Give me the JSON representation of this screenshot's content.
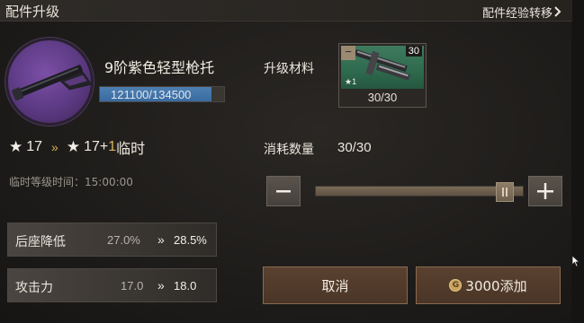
{
  "header": {
    "title": "配件升级",
    "transfer_label": "配件经验转移"
  },
  "weapon": {
    "name": "9阶紫色轻型枪托",
    "xp_text": "121100/134500",
    "xp_progress": 0.9
  },
  "stars": {
    "current": "17",
    "next": "17+",
    "bonus": "1",
    "suffix": "临时"
  },
  "temp_time": "临时等级时间：15:00:00",
  "stats": [
    {
      "label": "后座降低",
      "from": "27.0%",
      "to": "28.5%"
    },
    {
      "label": "攻击力",
      "from": "17.0",
      "to": "18.0"
    }
  ],
  "materials": {
    "label": "升级材料",
    "item_count": "30",
    "item_stars": "★1",
    "quantity": "30/30"
  },
  "consume": {
    "label": "消耗数量",
    "value": "30/30",
    "slider_fraction": 1.0
  },
  "buttons": {
    "cancel": "取消",
    "add": "3000添加"
  },
  "colors": {
    "accent_gold": "#d9b25a",
    "xp_blue": "#3a6ba0",
    "action_brown": "#4a3526",
    "item_green": "#2e6a4d",
    "weapon_purple": "#5c3a83"
  }
}
